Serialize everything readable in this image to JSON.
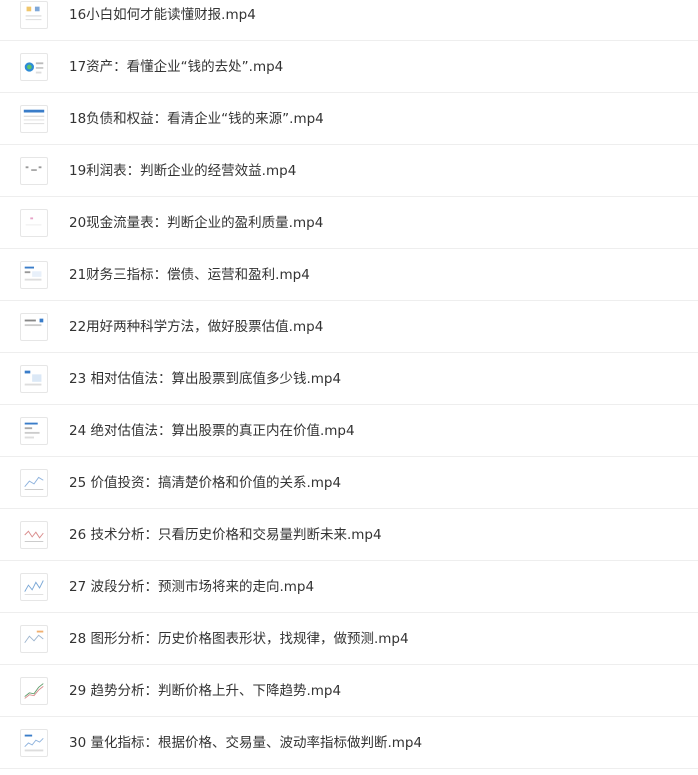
{
  "files": [
    {
      "name": "16小白如何才能读懂财报.mp4",
      "icon": "video-thumbnail-icon"
    },
    {
      "name": "17资产：看懂企业“钱的去处”.mp4",
      "icon": "video-thumbnail-icon"
    },
    {
      "name": "18负债和权益：看清企业“钱的来源”.mp4",
      "icon": "video-thumbnail-icon"
    },
    {
      "name": "19利润表：判断企业的经营效益.mp4",
      "icon": "video-thumbnail-icon"
    },
    {
      "name": "20现金流量表：判断企业的盈利质量.mp4",
      "icon": "video-thumbnail-icon"
    },
    {
      "name": "21财务三指标：偿债、运营和盈利.mp4",
      "icon": "video-thumbnail-icon"
    },
    {
      "name": "22用好两种科学方法，做好股票估值.mp4",
      "icon": "video-thumbnail-icon"
    },
    {
      "name": "23 相对估值法：算出股票到底值多少钱.mp4",
      "icon": "video-thumbnail-icon"
    },
    {
      "name": "24 绝对估值法：算出股票的真正内在价值.mp4",
      "icon": "video-thumbnail-icon"
    },
    {
      "name": "25 价值投资：搞清楚价格和价值的关系.mp4",
      "icon": "video-thumbnail-icon"
    },
    {
      "name": "26 技术分析：只看历史价格和交易量判断未来.mp4",
      "icon": "video-thumbnail-icon"
    },
    {
      "name": "27 波段分析：预测市场将来的走向.mp4",
      "icon": "video-thumbnail-icon"
    },
    {
      "name": "28 图形分析：历史价格图表形状，找规律，做预测.mp4",
      "icon": "video-thumbnail-icon"
    },
    {
      "name": "29 趋势分析：判断价格上升、下降趋势.mp4",
      "icon": "video-thumbnail-icon"
    },
    {
      "name": "30 量化指标：根据价格、交易量、波动率指标做判断.mp4",
      "icon": "video-thumbnail-icon"
    }
  ]
}
